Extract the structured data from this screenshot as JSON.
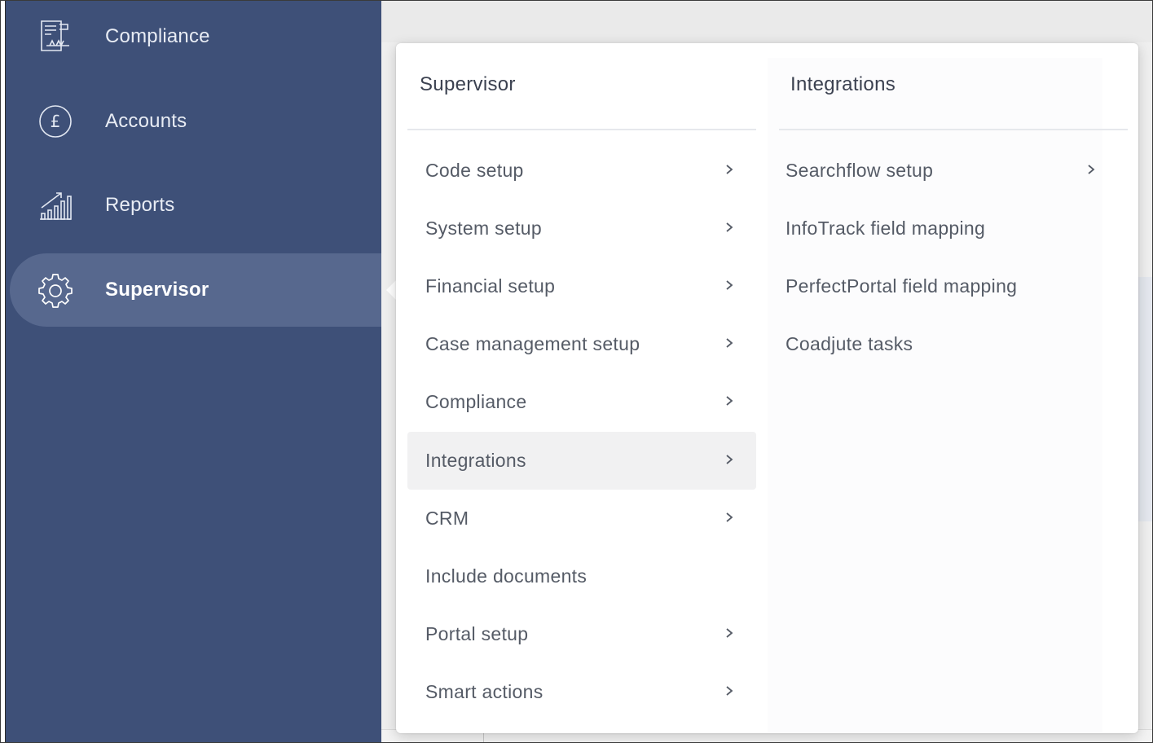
{
  "sidebar": {
    "items": [
      {
        "label": "Compliance",
        "icon": "compliance-certificate-icon",
        "active": false
      },
      {
        "label": "Accounts",
        "icon": "pound-circle-icon",
        "active": false
      },
      {
        "label": "Reports",
        "icon": "bar-chart-trend-icon",
        "active": false
      },
      {
        "label": "Supervisor",
        "icon": "gear-icon",
        "active": true
      }
    ]
  },
  "menu": {
    "left_column": {
      "title": "Supervisor",
      "items": [
        {
          "label": "Code setup",
          "has_submenu": true
        },
        {
          "label": "System setup",
          "has_submenu": true
        },
        {
          "label": "Financial setup",
          "has_submenu": true
        },
        {
          "label": "Case management setup",
          "has_submenu": true
        },
        {
          "label": "Compliance",
          "has_submenu": true
        },
        {
          "label": "Integrations",
          "has_submenu": true,
          "highlighted": true
        },
        {
          "label": "CRM",
          "has_submenu": true
        },
        {
          "label": "Include documents",
          "has_submenu": false
        },
        {
          "label": "Portal setup",
          "has_submenu": true
        },
        {
          "label": "Smart actions",
          "has_submenu": true
        }
      ]
    },
    "right_column": {
      "title": "Integrations",
      "items": [
        {
          "label": "Searchflow setup",
          "has_submenu": true
        },
        {
          "label": "InfoTrack field mapping",
          "has_submenu": false
        },
        {
          "label": "PerfectPortal field mapping",
          "has_submenu": false
        },
        {
          "label": "Coadjute tasks",
          "has_submenu": false
        }
      ]
    }
  },
  "colors": {
    "sidebar_bg": "#3e5078",
    "sidebar_active_bg": "#57688e",
    "menu_text": "#555b66",
    "menu_title": "#3b4150",
    "highlight_row": "#f1f1f2"
  }
}
